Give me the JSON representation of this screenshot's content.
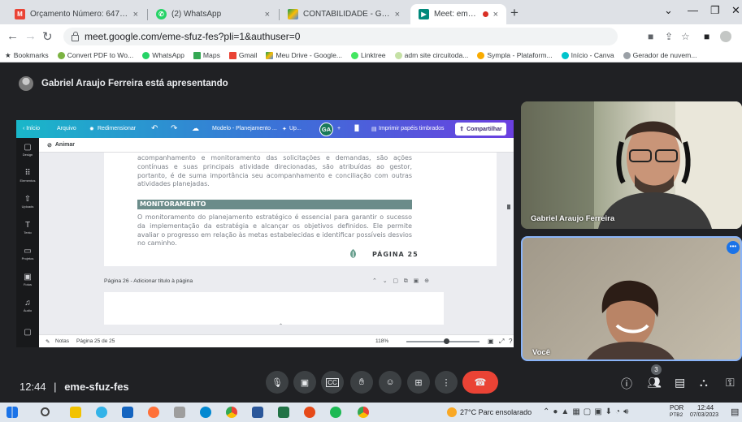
{
  "browser": {
    "tabs": [
      {
        "title": "Orçamento Número: 64789 - cir",
        "close": "×",
        "icon": "gmail-icon",
        "color": "#ea4335"
      },
      {
        "title": "(2) WhatsApp",
        "close": "×",
        "icon": "whatsapp-icon",
        "color": "#25d366"
      },
      {
        "title": "CONTABILIDADE - Google Drive",
        "close": "×",
        "icon": "google-drive-icon",
        "color": "#fbbc04"
      },
      {
        "title": "Meet: eme-sfuz-fes",
        "close": "×",
        "icon": "google-meet-icon",
        "color": "#00897b"
      }
    ],
    "new_tab": "+",
    "url": "meet.google.com/eme-sfuz-fes?pli=1&authuser=0",
    "bookmarks": [
      {
        "label": "Bookmarks",
        "color": "#202124"
      },
      {
        "label": "Convert PDF to Wo...",
        "color": "#7cb342"
      },
      {
        "label": "WhatsApp",
        "color": "#25d366"
      },
      {
        "label": "Maps",
        "color": "#34a853"
      },
      {
        "label": "Gmail",
        "color": "#ea4335"
      },
      {
        "label": "Meu Drive - Google...",
        "color": "#fbbc04"
      },
      {
        "label": "Linktree",
        "color": "#43e660"
      },
      {
        "label": "adm site circuitoda...",
        "color": "#9aa0a6"
      },
      {
        "label": "Sympla - Plataform...",
        "color": "#1a73e8"
      },
      {
        "label": "Início - Canva",
        "color": "#00c4cc"
      },
      {
        "label": "Gerador de nuvem...",
        "color": "#9aa0a6"
      }
    ]
  },
  "meet": {
    "presenting": "Gabriel Araujo Ferreira está apresentando",
    "time": "12:44",
    "separator": "|",
    "code": "eme-sfuz-fes",
    "participants": [
      {
        "name": "Gabriel Araujo Ferreira"
      },
      {
        "name": "Você"
      }
    ],
    "people_count": "3",
    "more": "•••"
  },
  "canva": {
    "toolbar": {
      "back": "‹ Início",
      "file": "Arquivo",
      "resize": "Redimensionar",
      "title": "Modelo - Planejamento ...",
      "upgrade": "Up...",
      "avatar": "GA",
      "plus": "+",
      "print": "Imprimir papéis timbrados",
      "share": "Compartilhar"
    },
    "sidebar": [
      {
        "label": "Design",
        "icon": "▢"
      },
      {
        "label": "Elementos",
        "icon": "⠿"
      },
      {
        "label": "Uploads",
        "icon": "⇧"
      },
      {
        "label": "Texto",
        "icon": "T"
      },
      {
        "label": "Projetos",
        "icon": "▭"
      },
      {
        "label": "Fotos",
        "icon": "▣"
      },
      {
        "label": "Áudio",
        "icon": "♫"
      }
    ],
    "animate": "Animar",
    "paragraph1": "acompanhamento e monitoramento das solicitações e demandas, são ações contínuas e suas principais atividade direcionadas, são atribuídas ao gestor, portanto, é de suma importância seu acompanhamento e conciliação com outras atividades planejadas.",
    "heading": "MONITORAMENTO",
    "paragraph2": "O monitoramento do planejamento estratégico é essencial para garantir o sucesso da implementação da estratégia e alcançar os objetivos definidos. Ele permite avaliar o progresso em relação às metas estabelecidas e identificar possíveis desvios no caminho.",
    "page_label": "PÁGINA 25",
    "page26": "Página 26 - Adicionar título à página",
    "notes": "Notas",
    "page_count": "Página 25 de 25",
    "zoom": "118%"
  },
  "taskbar": {
    "weather": "27°C  Parc ensolarado",
    "lang": "POR",
    "lang2": "PTB2",
    "clock_time": "12:44",
    "clock_date": "07/03/2023"
  }
}
